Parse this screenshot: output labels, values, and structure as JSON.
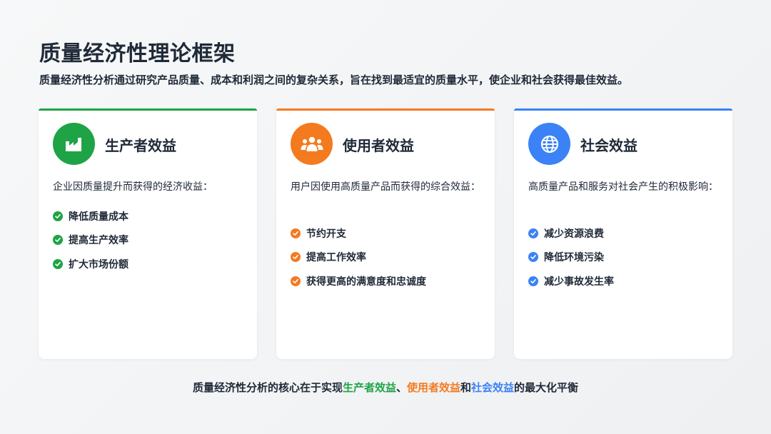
{
  "title": "质量经济性理论框架",
  "subtitle": "质量经济性分析通过研究产品质量、成本和利润之间的复杂关系，旨在找到最适宜的质量水平，使企业和社会获得最佳效益。",
  "colors": {
    "producer": "#1ea446",
    "user": "#f47a1f",
    "society": "#3b82f6"
  },
  "cards": [
    {
      "icon": "factory-icon",
      "title": "生产者效益",
      "description": "企业因质量提升而获得的经济收益：",
      "items": [
        "降低质量成本",
        "提高生产效率",
        "扩大市场份额"
      ]
    },
    {
      "icon": "users-icon",
      "title": "使用者效益",
      "description": "用户因使用高质量产品而获得的综合效益：",
      "items": [
        "节约开支",
        "提高工作效率",
        "获得更高的满意度和忠诚度"
      ]
    },
    {
      "icon": "globe-icon",
      "title": "社会效益",
      "description": "高质量产品和服务对社会产生的积极影响：",
      "items": [
        "减少资源浪费",
        "降低环境污染",
        "减少事故发生率"
      ]
    }
  ],
  "footer": {
    "prefix": "质量经济性分析的核心在于实现",
    "producer": "生产者效益",
    "sep1": "、",
    "user": "使用者效益",
    "sep2": "和",
    "society": "社会效益",
    "suffix": "的最大化平衡"
  }
}
